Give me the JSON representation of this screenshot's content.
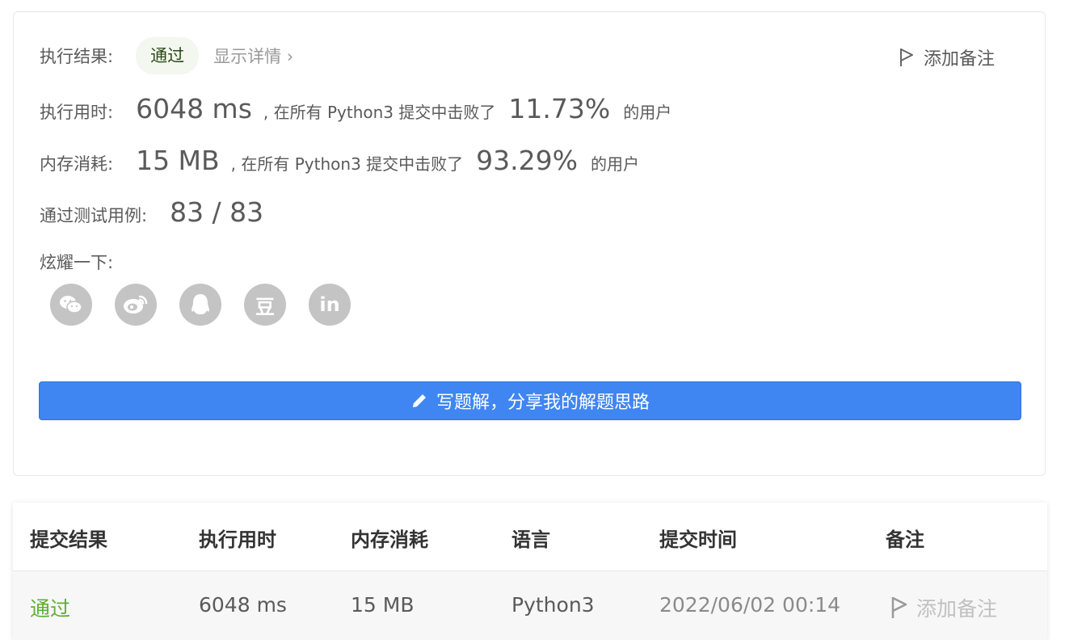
{
  "result": {
    "label": "执行结果:",
    "status": "通过",
    "details_link": "显示详情 ›",
    "add_note": "添加备注"
  },
  "runtime": {
    "label": "执行用时:",
    "value": "6048 ms",
    "middle_text": ", 在所有 Python3 提交中击败了",
    "percent": "11.73%",
    "suffix": "的用户"
  },
  "memory": {
    "label": "内存消耗:",
    "value": "15 MB",
    "middle_text": ", 在所有 Python3 提交中击败了",
    "percent": "93.29%",
    "suffix": "的用户"
  },
  "testcases": {
    "label": "通过测试用例:",
    "value": "83 / 83"
  },
  "share": {
    "label": "炫耀一下:",
    "icons": [
      "wechat-icon",
      "weibo-icon",
      "qq-icon",
      "douban-icon",
      "linkedin-icon"
    ],
    "douban_glyph": "豆",
    "linkedin_glyph": "in"
  },
  "write_solution_button": "写题解，分享我的解题思路",
  "colors": {
    "primary_button": "#3f86f2",
    "pass_green": "#5cb032",
    "icon_gray": "#c4c4c4"
  },
  "table": {
    "headers": [
      "提交结果",
      "执行用时",
      "内存消耗",
      "语言",
      "提交时间",
      "备注"
    ],
    "row": {
      "result": "通过",
      "runtime": "6048 ms",
      "memory": "15 MB",
      "language": "Python3",
      "time": "2022/06/02 00:14",
      "note": "添加备注"
    }
  }
}
